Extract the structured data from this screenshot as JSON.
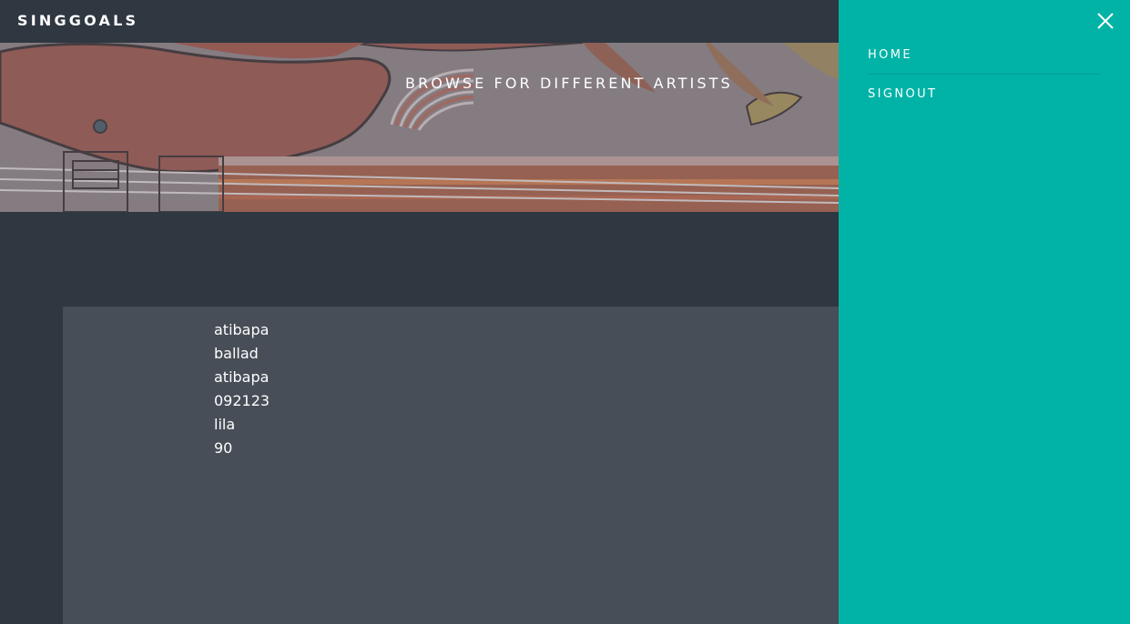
{
  "app": {
    "logo": "SINGGOALS"
  },
  "banner": {
    "title": "BROWSE FOR DIFFERENT ARTISTS"
  },
  "details": {
    "lines": [
      "atibapa",
      "ballad",
      "atibapa",
      "092123",
      "lila",
      "90"
    ]
  },
  "drawer": {
    "close_icon": "close-icon",
    "menu": [
      {
        "label": "HOME"
      },
      {
        "label": "SIGNOUT"
      }
    ]
  },
  "colors": {
    "background": "#2f3741",
    "card": "#474e57",
    "drawer": "#00b3a6",
    "text": "#ffffff"
  }
}
